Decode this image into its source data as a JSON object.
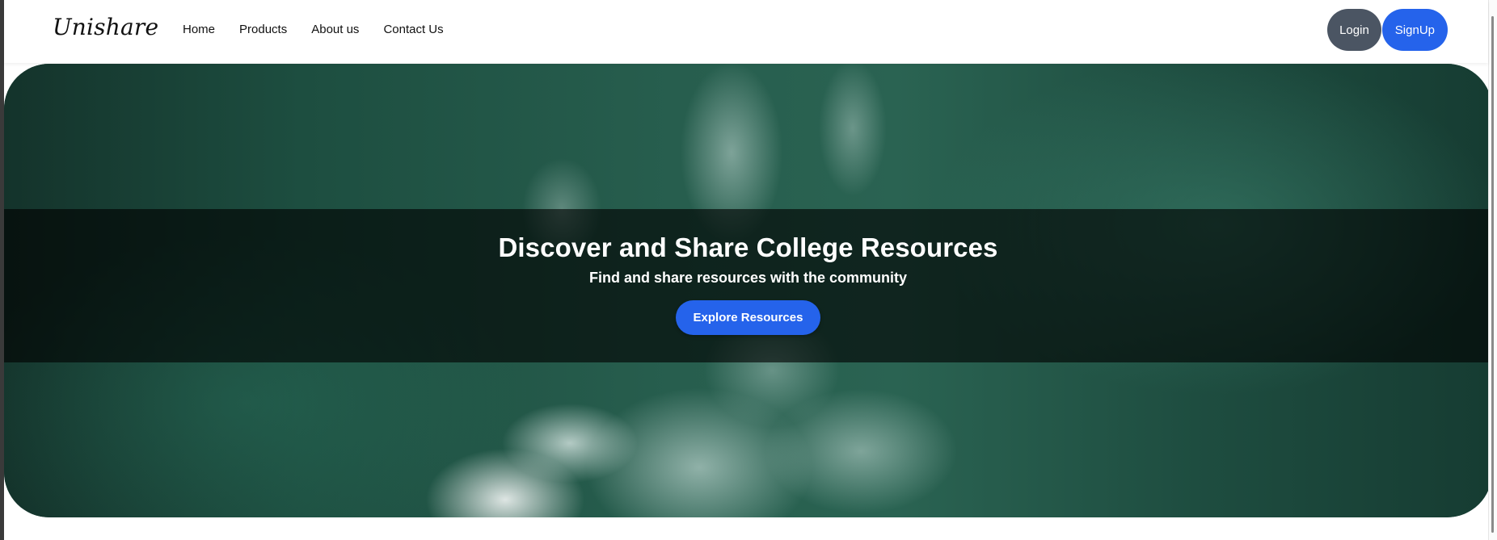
{
  "brand": "Unishare",
  "nav": {
    "links": [
      "Home",
      "Products",
      "About us",
      "Contact Us"
    ]
  },
  "auth": {
    "login_label": "Login",
    "signup_label": "SignUp"
  },
  "hero": {
    "title": "Discover and Share College Resources",
    "subtitle": "Find and share resources with the community",
    "cta_label": "Explore Resources"
  },
  "colors": {
    "accent": "#2563eb",
    "login_bg": "#4b5563"
  }
}
